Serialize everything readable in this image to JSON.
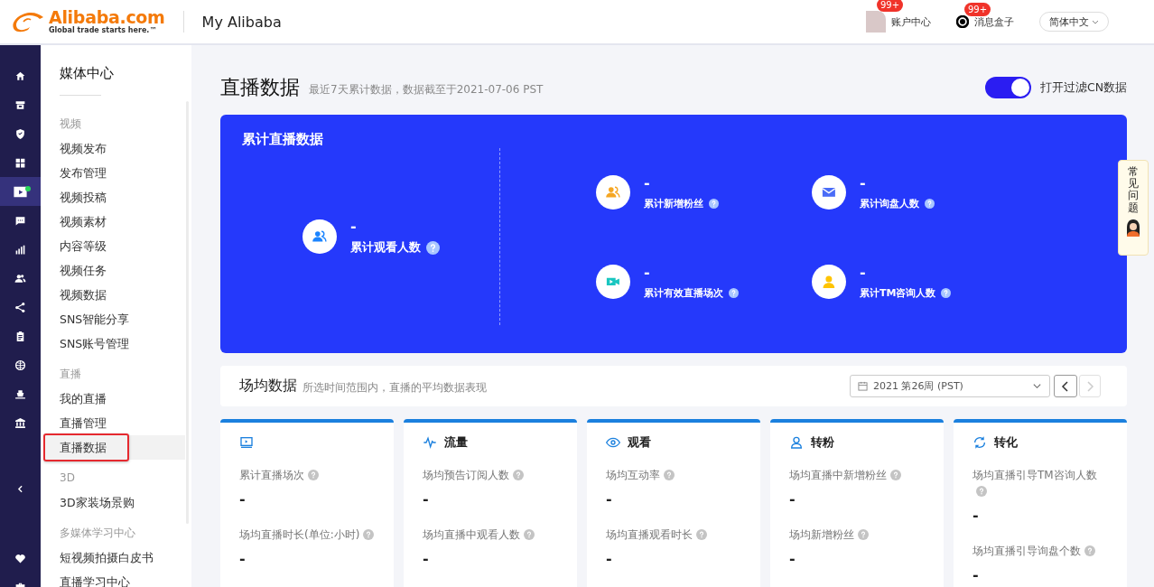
{
  "header": {
    "logo_text": "Alibaba.com",
    "logo_tagline": "Global trade starts here.™",
    "title": "My Alibaba",
    "account": {
      "label": "账户中心",
      "badge": "99+"
    },
    "messages": {
      "label": "消息盒子",
      "badge": "99+"
    },
    "language": "简体中文"
  },
  "rail": [
    {
      "items": [
        {
          "kind": "home",
          "selected": false,
          "notification": false
        },
        {
          "kind": "store",
          "selected": false,
          "notification": false
        },
        {
          "kind": "shield",
          "selected": false,
          "notification": false
        },
        {
          "kind": "apps",
          "selected": false,
          "notification": false
        },
        {
          "kind": "video",
          "selected": true,
          "notification": true
        },
        {
          "kind": "chat",
          "selected": false,
          "notification": false
        },
        {
          "kind": "chart",
          "selected": false,
          "notification": false
        },
        {
          "kind": "users",
          "selected": false,
          "notification": false
        },
        {
          "kind": "share",
          "selected": false,
          "notification": false
        },
        {
          "kind": "clipboard",
          "selected": false,
          "notification": false
        },
        {
          "kind": "globe",
          "selected": false,
          "notification": false
        },
        {
          "kind": "ship",
          "selected": false,
          "notification": false
        },
        {
          "kind": "bank",
          "selected": false,
          "notification": false
        }
      ]
    },
    {
      "items": [
        {
          "kind": "collapse",
          "selected": false,
          "notification": false
        }
      ]
    },
    {
      "items": [
        {
          "kind": "heart",
          "selected": false,
          "notification": false
        },
        {
          "kind": "briefcase",
          "selected": false,
          "notification": false
        }
      ]
    }
  ],
  "sidebar": {
    "title": "媒体中心",
    "groups": [
      {
        "heading": "视频",
        "items": [
          {
            "label": "视频发布",
            "selected": false
          },
          {
            "label": "发布管理",
            "selected": false
          },
          {
            "label": "视频投稿",
            "selected": false
          },
          {
            "label": "视频素材",
            "selected": false
          },
          {
            "label": "内容等级",
            "selected": false
          },
          {
            "label": "视频任务",
            "selected": false
          },
          {
            "label": "视频数据",
            "selected": false
          },
          {
            "label": "SNS智能分享",
            "selected": false
          },
          {
            "label": "SNS账号管理",
            "selected": false
          }
        ]
      },
      {
        "heading": "直播",
        "items": [
          {
            "label": "我的直播",
            "selected": false
          },
          {
            "label": "直播管理",
            "selected": false
          },
          {
            "label": "直播数据",
            "selected": true
          }
        ]
      },
      {
        "heading": "3D",
        "items": [
          {
            "label": "3D家装场景购",
            "selected": false
          }
        ]
      },
      {
        "heading": "多媒体学习中心",
        "items": [
          {
            "label": "短视频拍摄白皮书",
            "selected": false
          },
          {
            "label": "直播学习中心",
            "selected": false
          }
        ]
      }
    ]
  },
  "page": {
    "title": "直播数据",
    "subtitle": "最近7天累计数据，数据截至于2021-07-06 PST",
    "filter_toggle": {
      "label": "打开过滤CN数据",
      "on": true
    }
  },
  "summary": {
    "title": "累计直播数据",
    "main": {
      "kind": "viewers",
      "value": "-",
      "label": "累计观看人数"
    },
    "metrics": [
      {
        "kind": "fans",
        "value": "-",
        "label": "累计新增粉丝"
      },
      {
        "kind": "mail",
        "value": "-",
        "label": "累计询盘人数"
      },
      {
        "kind": "video",
        "value": "-",
        "label": "累计有效直播场次"
      },
      {
        "kind": "person",
        "value": "-",
        "label": "累计TM咨询人数"
      }
    ]
  },
  "faq_tab": {
    "label": "常见问题"
  },
  "averages": {
    "title": "场均数据",
    "subtitle": "所选时间范围内，直播的平均数据表现",
    "week_picker": "2021 第26周 (PST)",
    "prev_button": {
      "disabled": false
    },
    "next_button": {
      "disabled": true
    }
  },
  "cards": [
    {
      "kind": "screen",
      "metrics": [
        {
          "label": "累计直播场次",
          "value": "-"
        },
        {
          "label": "场均直播时长(单位:小时)",
          "value": "-"
        }
      ]
    },
    {
      "kind": "pulse",
      "title": "流量",
      "metrics": [
        {
          "label": "场均预告订阅人数",
          "value": "-"
        },
        {
          "label": "场均直播中观看人数",
          "value": "-"
        }
      ]
    },
    {
      "kind": "eye",
      "title": "观看",
      "metrics": [
        {
          "label": "场均互动率",
          "value": "-"
        },
        {
          "label": "场均直播观看时长",
          "value": "-"
        }
      ]
    },
    {
      "kind": "user",
      "title": "转粉",
      "metrics": [
        {
          "label": "场均直播中新增粉丝",
          "value": "-"
        },
        {
          "label": "场均新增粉丝",
          "value": "-"
        }
      ]
    },
    {
      "kind": "refresh",
      "title": "转化",
      "metrics": [
        {
          "label": "场均直播引导TM咨询人数",
          "value": "-"
        },
        {
          "label": "场均直播引导询盘个数",
          "value": "-"
        }
      ]
    }
  ]
}
